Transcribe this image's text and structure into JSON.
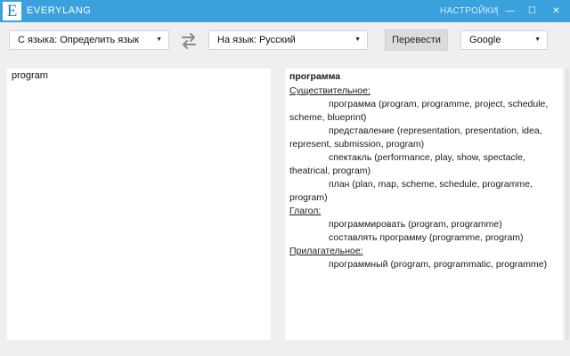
{
  "titlebar": {
    "logo": "E",
    "title": "EVERYLANG",
    "settings": "НАСТРОЙКИ",
    "minimize_glyph": "—",
    "maximize_glyph": "☐",
    "close_glyph": "✕"
  },
  "toolbar": {
    "from_lang": "С языка: Определить язык",
    "to_lang": "На язык: Русский",
    "translate_label": "Перевести",
    "provider": "Google"
  },
  "source": {
    "text": "program"
  },
  "result": {
    "headword": "программа",
    "groups": [
      {
        "pos": "Существительное:",
        "senses": [
          "программа (program, programme, project, schedule, scheme, blueprint)",
          "представление (representation, presentation, idea, represent, submission, program)",
          "спектакль (performance, play, show, spectacle, theatrical, program)",
          "план (plan, map, scheme, schedule, programme, program)"
        ]
      },
      {
        "pos": "Глагол:",
        "senses": [
          "программировать (program, programme)",
          "составлять программу (programme, program)"
        ]
      },
      {
        "pos": "Прилагательное:",
        "senses": [
          "программный (program, programmatic, programme)"
        ]
      }
    ]
  },
  "colors": {
    "titlebar": "#3aa1dc",
    "background": "#efefef",
    "translate_button": "#dcdcdc"
  },
  "icons": {
    "logo": "everylang-logo-icon",
    "swap": "swap-languages-icon",
    "dropdown": "chevron-down-icon"
  }
}
